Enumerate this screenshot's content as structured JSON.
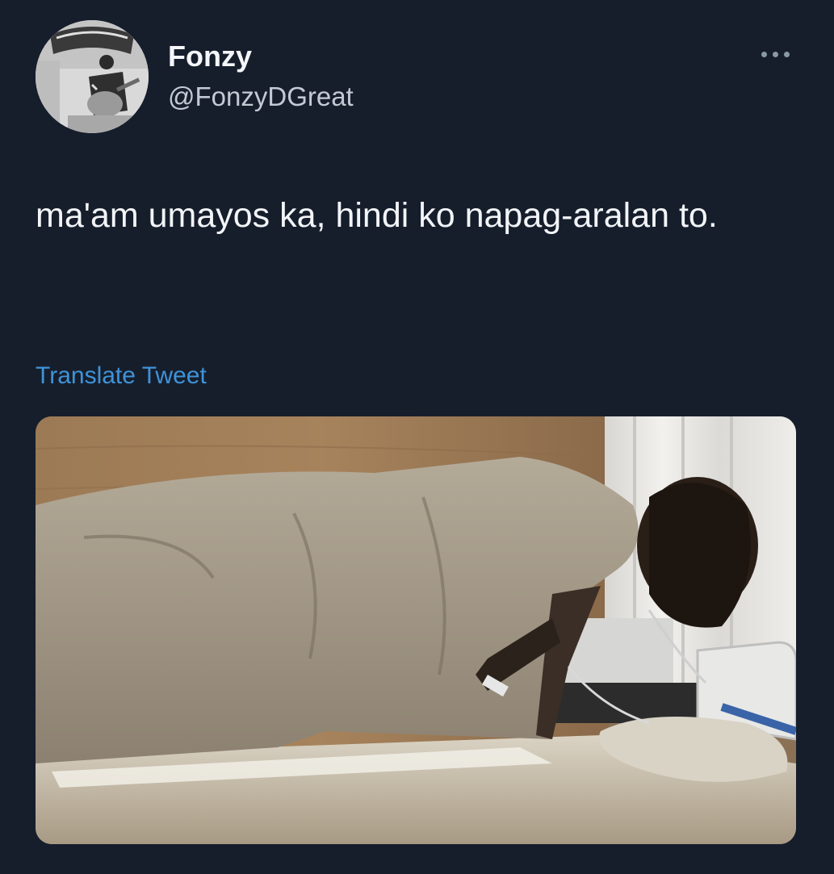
{
  "author": {
    "display_name": "Fonzy",
    "handle": "@FonzyDGreat",
    "avatar_icon": "profile-photo-guitar"
  },
  "tweet": {
    "text": "ma'am umayos ka, hindi ko napag-aralan to.",
    "translate_label": "Translate Tweet"
  },
  "media": {
    "icon": "photo-person-hovering-over-hospital-bed"
  },
  "colors": {
    "background": "#161e2c",
    "link": "#3f93d8",
    "handle": "#c3cad3"
  }
}
